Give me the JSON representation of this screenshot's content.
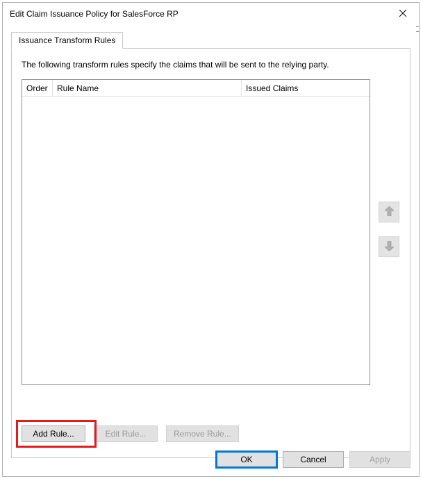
{
  "window": {
    "title": "Edit Claim Issuance Policy for SalesForce RP"
  },
  "tabs": {
    "active": "Issuance Transform Rules"
  },
  "intro_text": "The following transform rules specify the claims that will be sent to the relying party.",
  "columns": {
    "order": "Order",
    "rule_name": "Rule Name",
    "issued_claims": "Issued Claims"
  },
  "buttons": {
    "add_rule": "Add Rule...",
    "edit_rule": "Edit Rule...",
    "remove_rule": "Remove Rule...",
    "ok": "OK",
    "cancel": "Cancel",
    "apply": "Apply"
  }
}
